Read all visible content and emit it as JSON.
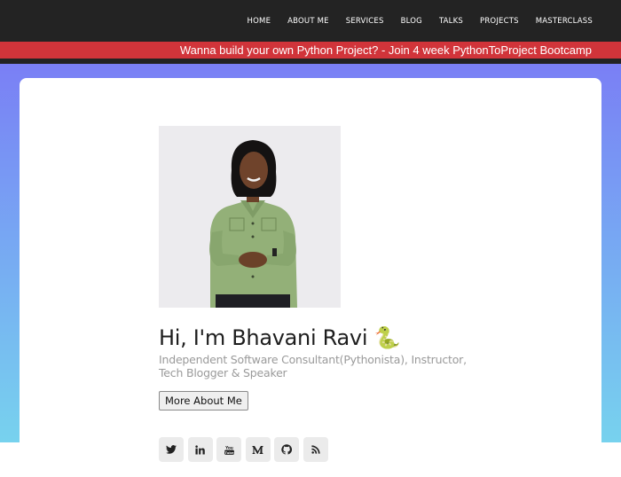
{
  "nav": {
    "items": [
      "HOME",
      "ABOUT ME",
      "SERVICES",
      "BLOG",
      "TALKS",
      "PROJECTS",
      "MASTERCLASS"
    ]
  },
  "banner": {
    "text": "Wanna build your own Python Project? - Join 4 week PythonToProject Bootcamp"
  },
  "hero": {
    "heading": "Hi, I'm Bhavani Ravi 🐍",
    "subtitle": "Independent Software Consultant(Pythonista), Instructor, Tech Blogger & Speaker",
    "button_label": "More About Me",
    "photo_alt": "Bhavani Ravi"
  },
  "social_icons": [
    "twitter-icon",
    "linkedin-icon",
    "youtube-icon",
    "medium-icon",
    "github-icon",
    "rss-icon"
  ],
  "colors": {
    "topbar": "#232323",
    "banner": "#d1343a",
    "gradient_top": "#7a7ff5",
    "gradient_bottom": "#77d2ee"
  }
}
